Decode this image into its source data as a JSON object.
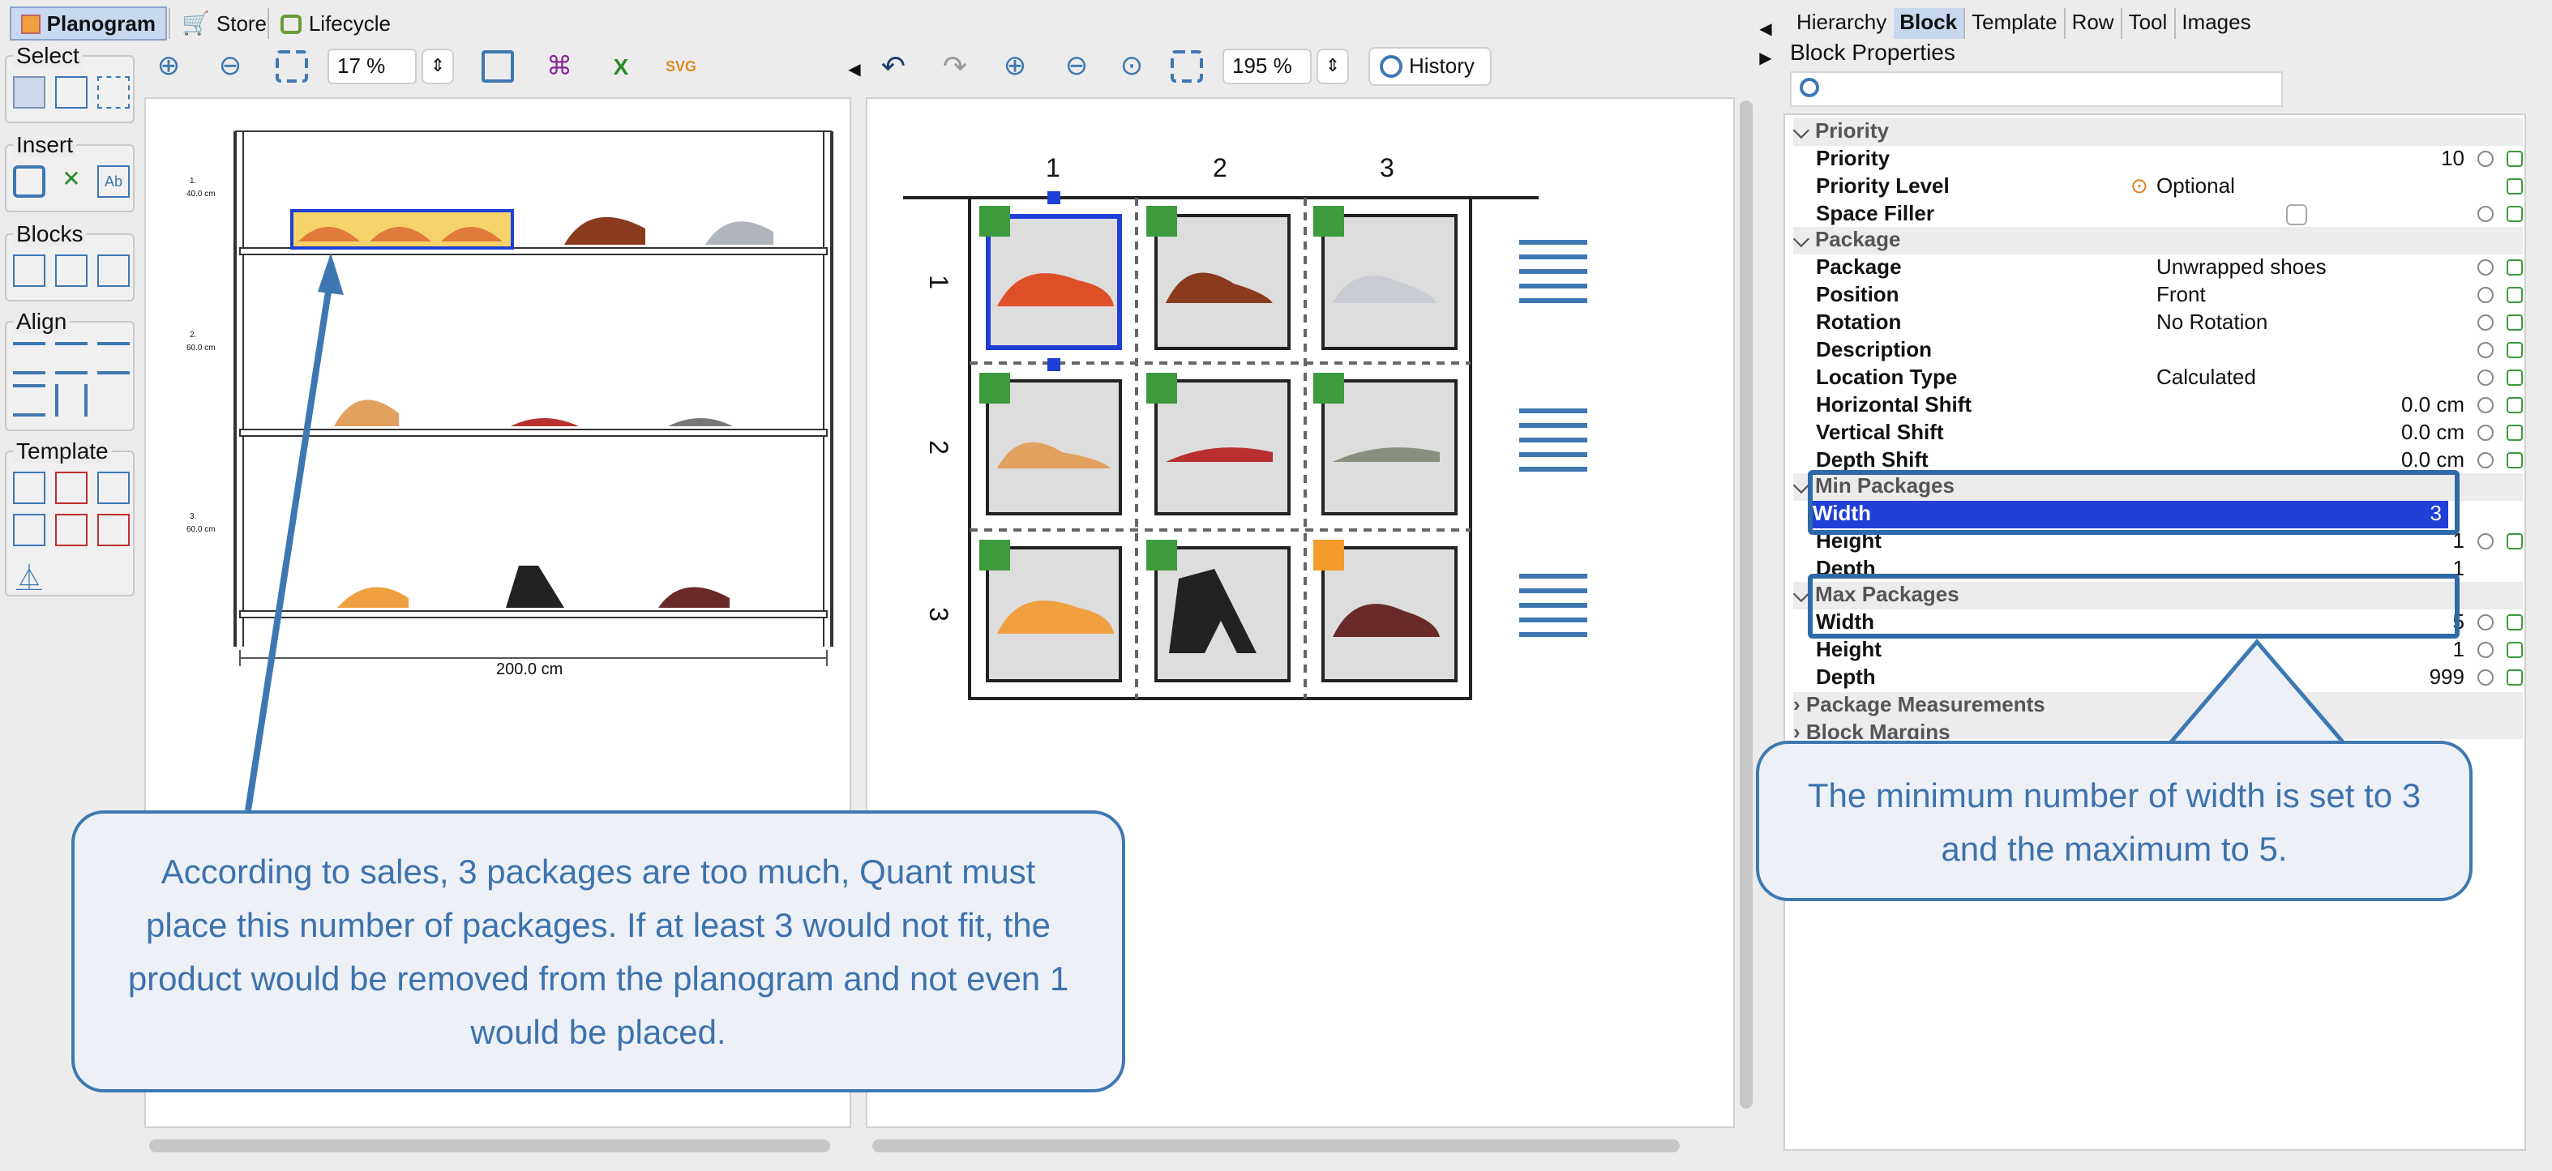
{
  "top_tabs": {
    "planogram": "Planogram",
    "store": "Store",
    "lifecycle": "Lifecycle"
  },
  "tool_groups": {
    "select": "Select",
    "insert": "Insert",
    "blocks": "Blocks",
    "align": "Align",
    "template": "Template"
  },
  "left_toolbar": {
    "zoom": "17 %"
  },
  "mid_toolbar": {
    "zoom": "195 %",
    "history": "History"
  },
  "shelf_view": {
    "shelves": [
      {
        "number": "1.",
        "height": "40.0 cm"
      },
      {
        "number": "2.",
        "height": "60.0 cm"
      },
      {
        "number": "3.",
        "height": "60.0 cm"
      }
    ],
    "width_label": "200.0 cm"
  },
  "block_grid": {
    "col_labels": [
      "1",
      "2",
      "3"
    ],
    "row_labels": [
      "1",
      "2",
      "3"
    ],
    "tag_colors": [
      "#3d9b3d",
      "#3d9b3d",
      "#3d9b3d",
      "#3d9b3d",
      "#3d9b3d",
      "#3d9b3d",
      "#3d9b3d",
      "#3d9b3d",
      "#f39a2a"
    ]
  },
  "right_tabs": [
    "Hierarchy",
    "Block",
    "Template",
    "Row",
    "Tool",
    "Images"
  ],
  "properties": {
    "title": "Block Properties",
    "categories": {
      "priority": "Priority",
      "package": "Package",
      "min_packages": "Min Packages",
      "max_packages": "Max Packages",
      "package_measurements": "Package Measurements",
      "block_margins": "Block Margins"
    },
    "priority": {
      "label": "Priority",
      "value": "10"
    },
    "priority_level": {
      "label": "Priority Level",
      "value": "Optional"
    },
    "space_filler": {
      "label": "Space Filler"
    },
    "package": {
      "label": "Package",
      "value": "Unwrapped shoes"
    },
    "position": {
      "label": "Position",
      "value": "Front"
    },
    "rotation": {
      "label": "Rotation",
      "value": "No Rotation"
    },
    "description": {
      "label": "Description",
      "value": ""
    },
    "location_type": {
      "label": "Location Type",
      "value": "Calculated"
    },
    "horizontal_shift": {
      "label": "Horizontal Shift",
      "value": "0.0 cm"
    },
    "vertical_shift": {
      "label": "Vertical Shift",
      "value": "0.0 cm"
    },
    "depth_shift": {
      "label": "Depth Shift",
      "value": "0.0 cm"
    },
    "min_width": {
      "label": "Width",
      "value": "3"
    },
    "min_height": {
      "label": "Height",
      "value": "1"
    },
    "min_depth": {
      "label": "Depth",
      "value": "1"
    },
    "max_width": {
      "label": "Width",
      "value": "5"
    },
    "max_height": {
      "label": "Height",
      "value": "1"
    },
    "max_depth": {
      "label": "Depth",
      "value": "999"
    }
  },
  "callouts": {
    "left": "According to sales, 3 packages are too much, Quant must place this number of packages. If at least 3 would not fit, the product would be removed from the planogram and not even 1 would be placed.",
    "right": "The minimum number of width is set to 3 and the maximum to 5."
  },
  "colors": {
    "accent": "#3e78b2",
    "selection": "#1f3fd6",
    "shoe_orange": "#e07a3a",
    "shoe_brown": "#8a3a1f"
  }
}
